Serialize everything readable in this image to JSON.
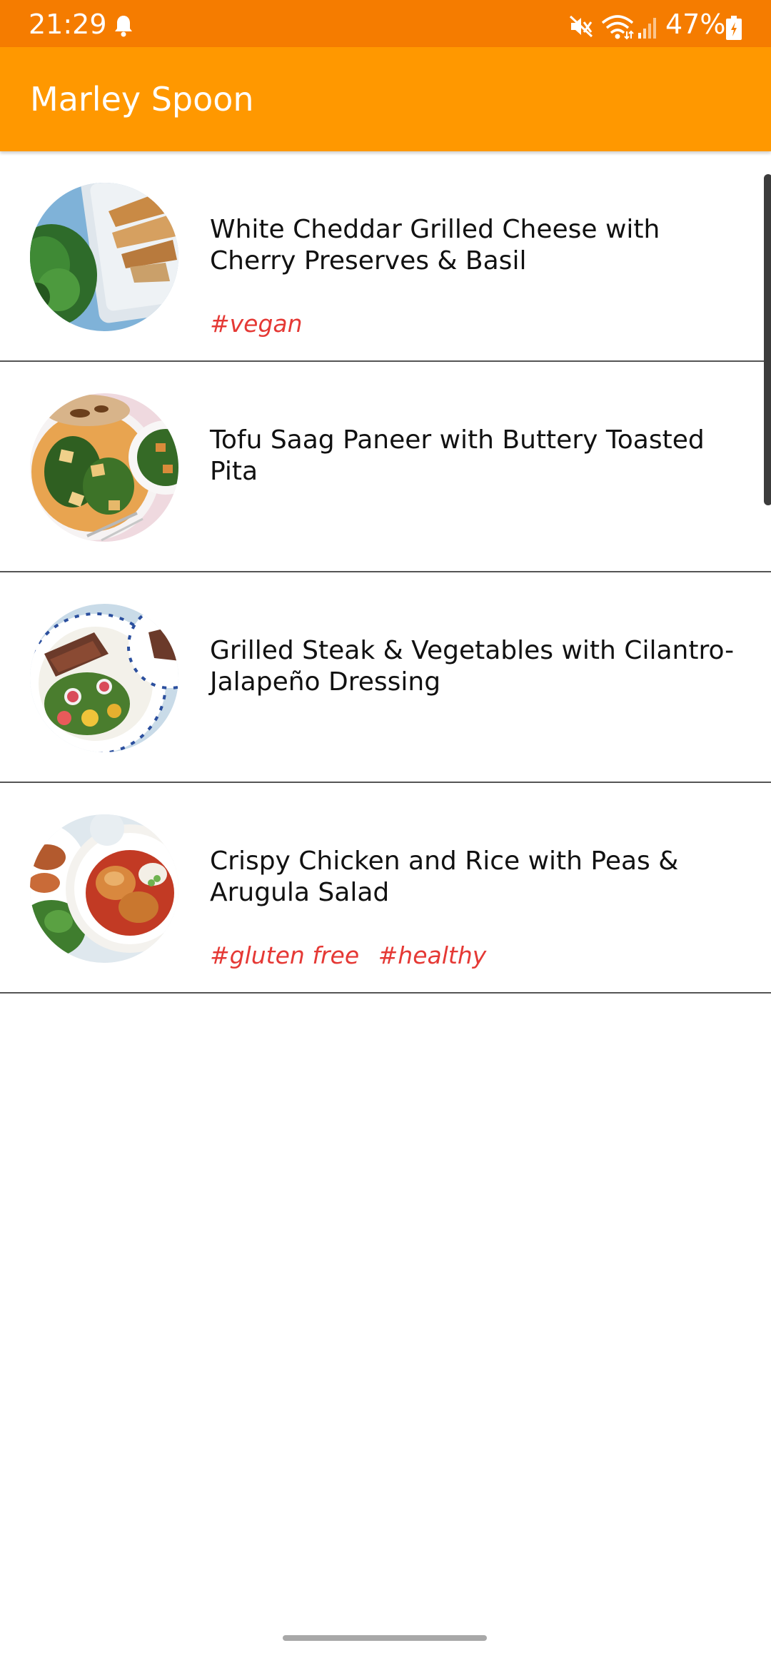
{
  "status_bar": {
    "time": "21:29",
    "battery": "47%",
    "icons": [
      "bell-icon",
      "mute-icon",
      "wifi-icon",
      "signal-icon",
      "battery-icon"
    ],
    "background_color": "#f57c00"
  },
  "app_bar": {
    "title": "Marley Spoon",
    "background_color": "#ff9800"
  },
  "recipes": [
    {
      "title": "White Cheddar Grilled Cheese with Cherry Preserves & Basil",
      "tags": [
        "#vegan"
      ]
    },
    {
      "title": "Tofu Saag Paneer with Buttery Toasted Pita",
      "tags": []
    },
    {
      "title": "Grilled Steak & Vegetables with Cilantro-Jalapeño Dressing",
      "tags": []
    },
    {
      "title": "Crispy Chicken and Rice with Peas & Arugula Salad",
      "tags": [
        "#gluten free",
        "#healthy"
      ]
    }
  ],
  "colors": {
    "tag": "#e53935",
    "divider": "#555555"
  }
}
